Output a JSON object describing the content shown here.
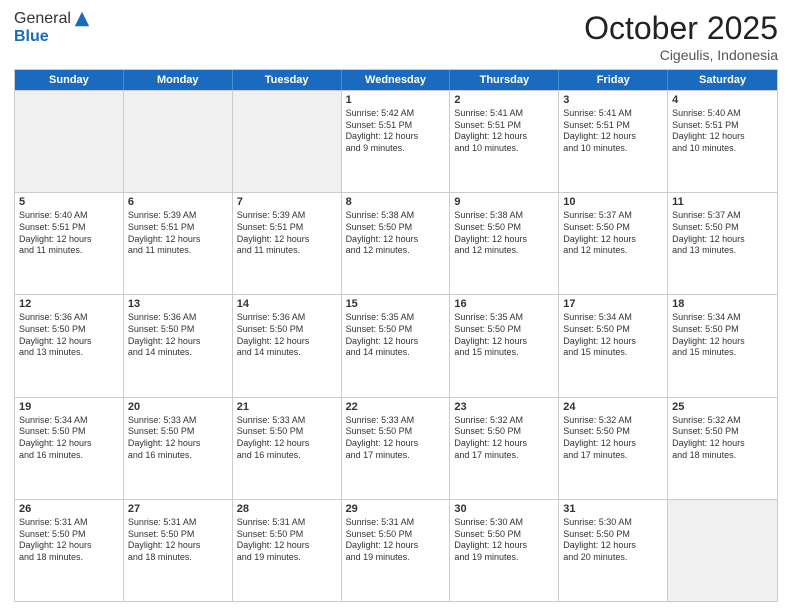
{
  "header": {
    "logo_general": "General",
    "logo_blue": "Blue",
    "month": "October 2025",
    "location": "Cigeulis, Indonesia"
  },
  "weekdays": [
    "Sunday",
    "Monday",
    "Tuesday",
    "Wednesday",
    "Thursday",
    "Friday",
    "Saturday"
  ],
  "rows": [
    [
      {
        "day": "",
        "lines": [],
        "shaded": true
      },
      {
        "day": "",
        "lines": [],
        "shaded": true
      },
      {
        "day": "",
        "lines": [],
        "shaded": true
      },
      {
        "day": "1",
        "lines": [
          "Sunrise: 5:42 AM",
          "Sunset: 5:51 PM",
          "Daylight: 12 hours",
          "and 9 minutes."
        ]
      },
      {
        "day": "2",
        "lines": [
          "Sunrise: 5:41 AM",
          "Sunset: 5:51 PM",
          "Daylight: 12 hours",
          "and 10 minutes."
        ]
      },
      {
        "day": "3",
        "lines": [
          "Sunrise: 5:41 AM",
          "Sunset: 5:51 PM",
          "Daylight: 12 hours",
          "and 10 minutes."
        ]
      },
      {
        "day": "4",
        "lines": [
          "Sunrise: 5:40 AM",
          "Sunset: 5:51 PM",
          "Daylight: 12 hours",
          "and 10 minutes."
        ]
      }
    ],
    [
      {
        "day": "5",
        "lines": [
          "Sunrise: 5:40 AM",
          "Sunset: 5:51 PM",
          "Daylight: 12 hours",
          "and 11 minutes."
        ]
      },
      {
        "day": "6",
        "lines": [
          "Sunrise: 5:39 AM",
          "Sunset: 5:51 PM",
          "Daylight: 12 hours",
          "and 11 minutes."
        ]
      },
      {
        "day": "7",
        "lines": [
          "Sunrise: 5:39 AM",
          "Sunset: 5:51 PM",
          "Daylight: 12 hours",
          "and 11 minutes."
        ]
      },
      {
        "day": "8",
        "lines": [
          "Sunrise: 5:38 AM",
          "Sunset: 5:50 PM",
          "Daylight: 12 hours",
          "and 12 minutes."
        ]
      },
      {
        "day": "9",
        "lines": [
          "Sunrise: 5:38 AM",
          "Sunset: 5:50 PM",
          "Daylight: 12 hours",
          "and 12 minutes."
        ]
      },
      {
        "day": "10",
        "lines": [
          "Sunrise: 5:37 AM",
          "Sunset: 5:50 PM",
          "Daylight: 12 hours",
          "and 12 minutes."
        ]
      },
      {
        "day": "11",
        "lines": [
          "Sunrise: 5:37 AM",
          "Sunset: 5:50 PM",
          "Daylight: 12 hours",
          "and 13 minutes."
        ]
      }
    ],
    [
      {
        "day": "12",
        "lines": [
          "Sunrise: 5:36 AM",
          "Sunset: 5:50 PM",
          "Daylight: 12 hours",
          "and 13 minutes."
        ]
      },
      {
        "day": "13",
        "lines": [
          "Sunrise: 5:36 AM",
          "Sunset: 5:50 PM",
          "Daylight: 12 hours",
          "and 14 minutes."
        ]
      },
      {
        "day": "14",
        "lines": [
          "Sunrise: 5:36 AM",
          "Sunset: 5:50 PM",
          "Daylight: 12 hours",
          "and 14 minutes."
        ]
      },
      {
        "day": "15",
        "lines": [
          "Sunrise: 5:35 AM",
          "Sunset: 5:50 PM",
          "Daylight: 12 hours",
          "and 14 minutes."
        ]
      },
      {
        "day": "16",
        "lines": [
          "Sunrise: 5:35 AM",
          "Sunset: 5:50 PM",
          "Daylight: 12 hours",
          "and 15 minutes."
        ]
      },
      {
        "day": "17",
        "lines": [
          "Sunrise: 5:34 AM",
          "Sunset: 5:50 PM",
          "Daylight: 12 hours",
          "and 15 minutes."
        ]
      },
      {
        "day": "18",
        "lines": [
          "Sunrise: 5:34 AM",
          "Sunset: 5:50 PM",
          "Daylight: 12 hours",
          "and 15 minutes."
        ]
      }
    ],
    [
      {
        "day": "19",
        "lines": [
          "Sunrise: 5:34 AM",
          "Sunset: 5:50 PM",
          "Daylight: 12 hours",
          "and 16 minutes."
        ]
      },
      {
        "day": "20",
        "lines": [
          "Sunrise: 5:33 AM",
          "Sunset: 5:50 PM",
          "Daylight: 12 hours",
          "and 16 minutes."
        ]
      },
      {
        "day": "21",
        "lines": [
          "Sunrise: 5:33 AM",
          "Sunset: 5:50 PM",
          "Daylight: 12 hours",
          "and 16 minutes."
        ]
      },
      {
        "day": "22",
        "lines": [
          "Sunrise: 5:33 AM",
          "Sunset: 5:50 PM",
          "Daylight: 12 hours",
          "and 17 minutes."
        ]
      },
      {
        "day": "23",
        "lines": [
          "Sunrise: 5:32 AM",
          "Sunset: 5:50 PM",
          "Daylight: 12 hours",
          "and 17 minutes."
        ]
      },
      {
        "day": "24",
        "lines": [
          "Sunrise: 5:32 AM",
          "Sunset: 5:50 PM",
          "Daylight: 12 hours",
          "and 17 minutes."
        ]
      },
      {
        "day": "25",
        "lines": [
          "Sunrise: 5:32 AM",
          "Sunset: 5:50 PM",
          "Daylight: 12 hours",
          "and 18 minutes."
        ]
      }
    ],
    [
      {
        "day": "26",
        "lines": [
          "Sunrise: 5:31 AM",
          "Sunset: 5:50 PM",
          "Daylight: 12 hours",
          "and 18 minutes."
        ]
      },
      {
        "day": "27",
        "lines": [
          "Sunrise: 5:31 AM",
          "Sunset: 5:50 PM",
          "Daylight: 12 hours",
          "and 18 minutes."
        ]
      },
      {
        "day": "28",
        "lines": [
          "Sunrise: 5:31 AM",
          "Sunset: 5:50 PM",
          "Daylight: 12 hours",
          "and 19 minutes."
        ]
      },
      {
        "day": "29",
        "lines": [
          "Sunrise: 5:31 AM",
          "Sunset: 5:50 PM",
          "Daylight: 12 hours",
          "and 19 minutes."
        ]
      },
      {
        "day": "30",
        "lines": [
          "Sunrise: 5:30 AM",
          "Sunset: 5:50 PM",
          "Daylight: 12 hours",
          "and 19 minutes."
        ]
      },
      {
        "day": "31",
        "lines": [
          "Sunrise: 5:30 AM",
          "Sunset: 5:50 PM",
          "Daylight: 12 hours",
          "and 20 minutes."
        ]
      },
      {
        "day": "",
        "lines": [],
        "shaded": true
      }
    ]
  ]
}
